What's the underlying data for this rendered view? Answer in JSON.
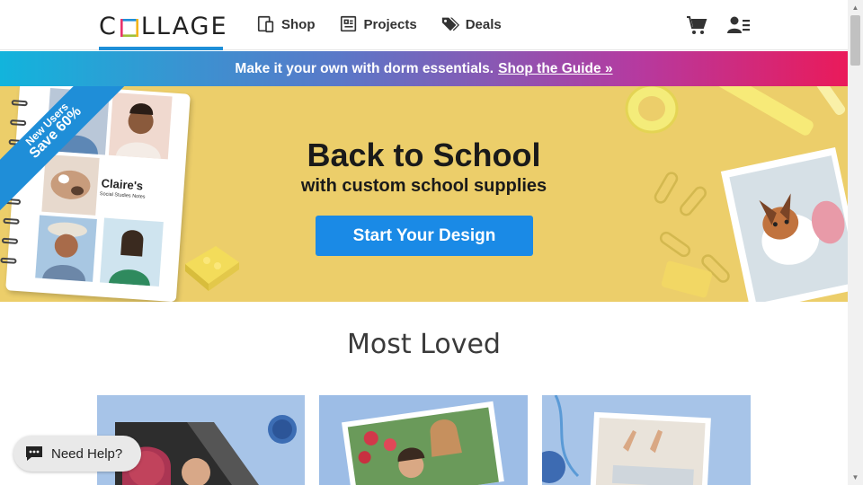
{
  "header": {
    "logo_text": "COLLAGE",
    "nav": [
      {
        "label": "Shop",
        "icon": "shop-icon"
      },
      {
        "label": "Projects",
        "icon": "projects-icon"
      },
      {
        "label": "Deals",
        "icon": "tags-icon"
      }
    ],
    "cart_icon": "cart-icon",
    "account_icon": "account-icon"
  },
  "promo": {
    "text": "Make it your own with dorm essentials.",
    "link": "Shop the Guide »"
  },
  "hero": {
    "ribbon_line1": "New Users",
    "ribbon_line2": "Save 60%",
    "title": "Back to School",
    "subtitle": "with custom school supplies",
    "cta": "Start Your Design",
    "notebook_name": "Claire's",
    "notebook_caption": "Social Studies Notes"
  },
  "section": {
    "title": "Most Loved"
  },
  "help": {
    "label": "Need Help?"
  },
  "colors": {
    "accent": "#1a8ae6",
    "hero_bg": "#ecce6a",
    "card_bg": "#a7c4e8"
  }
}
